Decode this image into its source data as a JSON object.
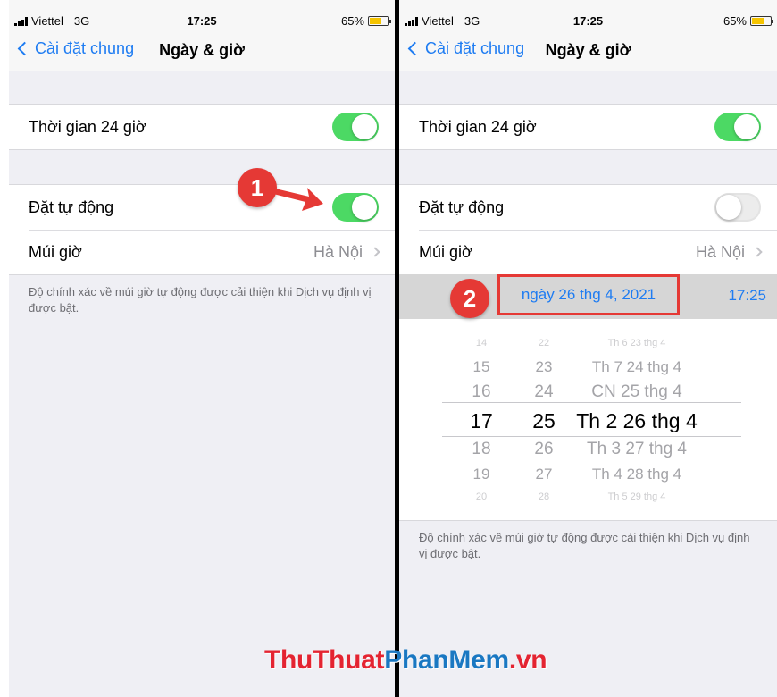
{
  "status": {
    "carrier": "Viettel",
    "network": "3G",
    "time": "17:25",
    "battery": "65%",
    "battery_level": 0.65
  },
  "nav": {
    "back_label": "Cài đặt chung",
    "title": "Ngày & giờ"
  },
  "settings": {
    "time24_label": "Thời gian 24 giờ",
    "auto_label": "Đặt tự động",
    "timezone_label": "Múi giờ",
    "timezone_value": "Hà Nội",
    "footnote": "Độ chính xác về múi giờ tự động được cải thiện khi Dịch vụ định vị được bật."
  },
  "left_state": {
    "time24_on": true,
    "auto_on": true
  },
  "right_state": {
    "time24_on": true,
    "auto_on": false
  },
  "date_display": "ngày 26 thg 4, 2021",
  "time_display": "17:25",
  "picker": {
    "hours": [
      "14",
      "15",
      "16",
      "17",
      "18",
      "19",
      "20"
    ],
    "minutes": [
      "22",
      "23",
      "24",
      "25",
      "26",
      "27",
      "28"
    ],
    "days": [
      "Th 6 23 thg 4",
      "Th 7 24 thg 4",
      "CN 25 thg 4",
      "Th 2 26 thg 4",
      "Th 3 27 thg 4",
      "Th 4 28 thg 4",
      "Th 5 29 thg 4"
    ],
    "selected_index": 3
  },
  "annotations": {
    "step1": "1",
    "step2": "2"
  },
  "watermark": {
    "part1": "ThuThuat",
    "part2": "PhanMem",
    "part3": ".vn"
  },
  "colors": {
    "toggle_on": "#4cd964",
    "accent": "#1e7cf2",
    "annotation": "#e53935"
  }
}
